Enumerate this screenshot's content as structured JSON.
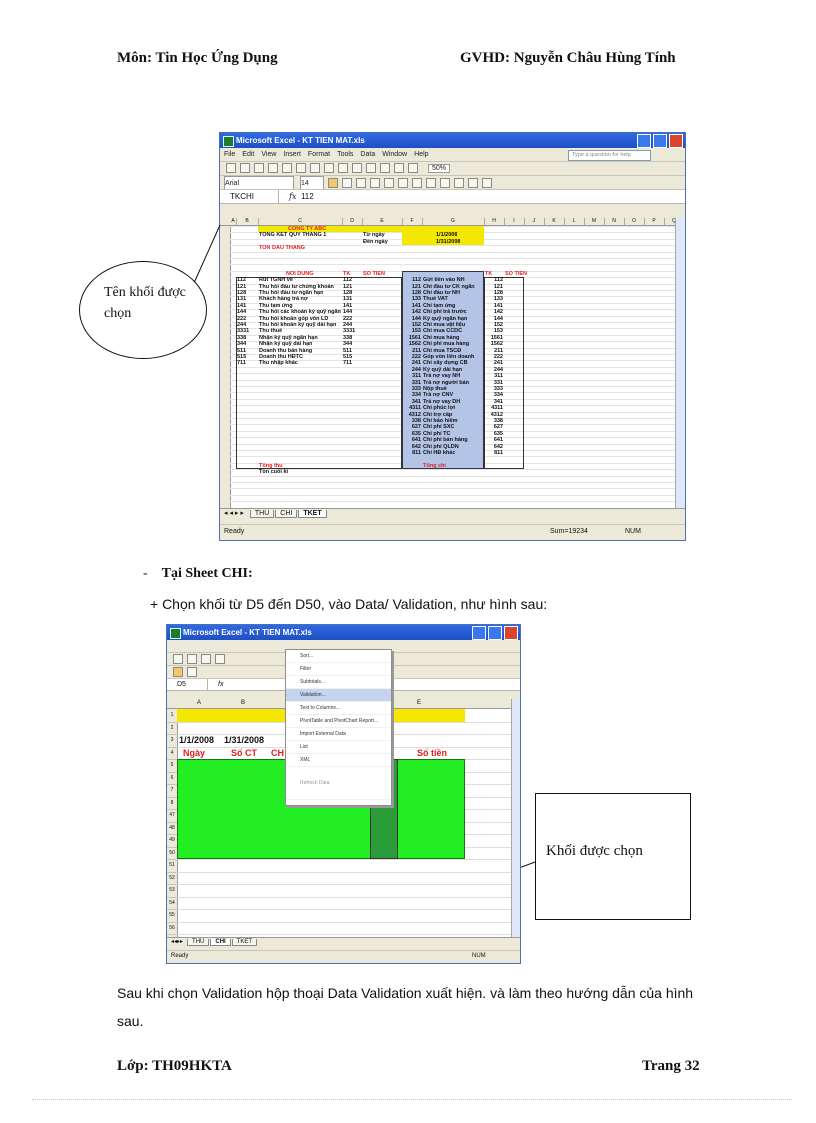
{
  "header": {
    "subject": "Môn: Tin Học Ứng Dụng",
    "teacher": "GVHD: Nguyễn Châu Hùng Tính"
  },
  "screenshot1": {
    "title": "Microsoft Excel - KT TIEN MAT.xls",
    "menu": [
      "File",
      "Edit",
      "View",
      "Insert",
      "Format",
      "Tools",
      "Data",
      "Window",
      "Help"
    ],
    "help_placeholder": "Type a question for help",
    "font": "Arial",
    "font_size": "14",
    "zoom": "50%",
    "name_box": "TKCHI",
    "formula_value": "112",
    "columns": [
      "A",
      "B",
      "C",
      "D",
      "E",
      "F",
      "G",
      "H",
      "I",
      "J",
      "K",
      "L",
      "M",
      "N",
      "O",
      "P",
      "Q"
    ],
    "company": "CONG TY ABC",
    "title_row": "TONG KET QUY THANG 1",
    "label_from": "Từ ngày",
    "label_to": "Đến ngày",
    "date_from": "1/1/2008",
    "date_to": "1/31/2008",
    "opening": "TON DAU THANG",
    "col_left": [
      "NOI DUNG",
      "TK",
      "SO TIEN"
    ],
    "col_right": [
      "NOI DUNG",
      "TK",
      "SO TIEN"
    ],
    "left_rows": [
      [
        "112",
        "Rút TGNH về"
      ],
      [
        "121",
        "Thu hồi đầu tư chứng khoán"
      ],
      [
        "128",
        "Thu hồi đầu tư ngắn hạn"
      ],
      [
        "131",
        "Khách hàng trả nợ"
      ],
      [
        "141",
        "Thu tạm ứng"
      ],
      [
        "144",
        "Thu hồi các khoản ký quỹ ngắn"
      ],
      [
        "222",
        "Thu hồi khoản góp vốn LD"
      ],
      [
        "244",
        "Thu hồi khoản ký quỹ dài hạn"
      ],
      [
        "3331",
        "Thu thuế"
      ],
      [
        "338",
        "Nhận ký quỹ ngắn hạn"
      ],
      [
        "344",
        "Nhận ký quỹ dài hạn"
      ],
      [
        "511",
        "Doanh thu bán hàng"
      ],
      [
        "515",
        "Doanh thu HĐTC"
      ],
      [
        "711",
        "Thu nhập khác"
      ]
    ],
    "right_rows": [
      [
        "112",
        "Gửi tiền vào NH"
      ],
      [
        "121",
        "Chi đầu tư CK ngắn"
      ],
      [
        "128",
        "Chi đầu tư NH"
      ],
      [
        "133",
        "Thuế VAT"
      ],
      [
        "141",
        "Chi tạm ứng"
      ],
      [
        "142",
        "Chi phí trả trước"
      ],
      [
        "144",
        "Ký quỹ ngắn hạn"
      ],
      [
        "152",
        "Chi mua vật liệu"
      ],
      [
        "153",
        "Chi mua CCDC"
      ],
      [
        "1561",
        "Chi mua hàng"
      ],
      [
        "1562",
        "Chi phí mua hàng"
      ],
      [
        "211",
        "Chi mua TSCĐ"
      ],
      [
        "222",
        "Góp vốn liên doanh"
      ],
      [
        "241",
        "Chi xây dựng CB"
      ],
      [
        "244",
        "Ký quỹ dài hạn"
      ],
      [
        "311",
        "Trả nợ vay NH"
      ],
      [
        "331",
        "Trả nợ người bán"
      ],
      [
        "333",
        "Nộp thuế"
      ],
      [
        "334",
        "Trả nợ CNV"
      ],
      [
        "341",
        "Trả nợ vay DH"
      ],
      [
        "4311",
        "Chi phúc lợi"
      ],
      [
        "4312",
        "Chi trợ cấp"
      ],
      [
        "338",
        "Chi bảo hiểm"
      ],
      [
        "627",
        "Chi phí SXC"
      ],
      [
        "635",
        "Chi phí TC"
      ],
      [
        "641",
        "Chi phí bán hàng"
      ],
      [
        "642",
        "Chi phí QLDN"
      ],
      [
        "811",
        "Chi HĐ khác"
      ]
    ],
    "total_in": "Tổng thu",
    "closing": "Tồn cuối kì",
    "total_out": "Tổng chi",
    "tabs": [
      "THU",
      "CHI",
      "TKET"
    ],
    "active_tab": "TKET",
    "status_ready": "Ready",
    "status_sum": "Sum=19234",
    "status_num": "NUM"
  },
  "callout1": "Tên khối được chọn",
  "bullet1_dash": "-",
  "bullet1": "Tại Sheet CHI:",
  "bullet2": "+  Chọn khối từ D5 đến D50, vào Data/ Validation, như hình sau:",
  "screenshot2": {
    "title": "Microsoft Excel - KT TIEN MAT.xls",
    "name_box": "D5",
    "columns": [
      "A",
      "B",
      "C",
      "D",
      "E"
    ],
    "date_from": "1/1/2008",
    "date_to": "1/31/2008",
    "headers": [
      "Ngày",
      "Số CT",
      "CH",
      "",
      "Số tiền"
    ],
    "row_numbers": [
      "1",
      "2",
      "3",
      "4",
      "5",
      "6",
      "7",
      "8",
      "47",
      "48",
      "49",
      "50",
      "51",
      "52",
      "53",
      "54",
      "55",
      "56"
    ],
    "menu_items": [
      "Sort...",
      "Filter",
      "Subtotals...",
      "Validation...",
      "Text to Columns...",
      "PivotTable and PivotChart Report...",
      "Import External Data",
      "List",
      "XML",
      "Refresh Data"
    ],
    "tabs": [
      "THU",
      "CHI",
      "TKET"
    ],
    "active_tab": "CHI",
    "status_ready": "Ready",
    "status_num": "NUM"
  },
  "callout2": "Khối được chọn",
  "paragraph": "Sau khi chọn Validation hộp thoại Data Validation xuất hiện. và làm theo hướng dẫn của hình sau.",
  "footer": {
    "class": "Lớp: TH09HKTA",
    "page": "Trang 32"
  }
}
